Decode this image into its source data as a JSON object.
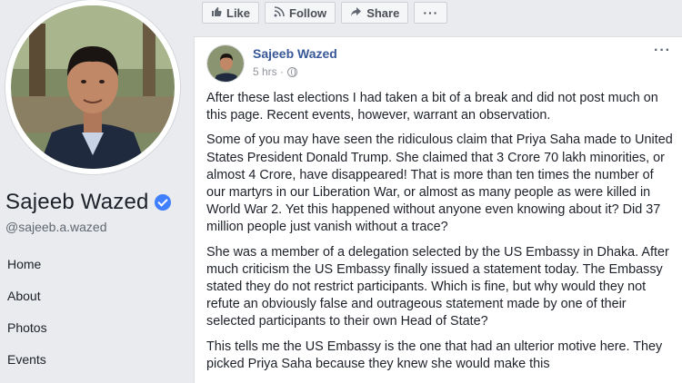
{
  "profile": {
    "name": "Sajeeb Wazed",
    "username": "@sajeeb.a.wazed"
  },
  "nav": {
    "items": [
      {
        "label": "Home"
      },
      {
        "label": "About"
      },
      {
        "label": "Photos"
      },
      {
        "label": "Events"
      }
    ]
  },
  "actions": {
    "like": "Like",
    "follow": "Follow",
    "share": "Share",
    "more": "···"
  },
  "post": {
    "author": "Sajeeb Wazed",
    "time": "5 hrs ·",
    "options": "···",
    "paragraphs": [
      "After these last elections I had taken a bit of a break and did not post much on this page. Recent events, however, warrant an observation.",
      "Some of you may have seen the ridiculous claim that Priya Saha made to United States President Donald Trump. She claimed that 3 Crore 70 lakh minorities, or almost 4 Crore, have disappeared! That is more than ten times the number of our martyrs in our Liberation War, or almost as many people as were killed in World War 2. Yet this happened without anyone even knowing about it? Did 37 million people just vanish without a trace?",
      "She was a member of a delegation selected by the US Embassy in Dhaka. After much criticism the US Embassy finally issued a statement today. The Embassy stated they do not restrict participants. Which is fine, but why would they not refute an obviously false and outrageous statement made by one of their selected participants to their own Head of State?",
      "This tells me the US Embassy is the one that had an ulterior motive here. They picked Priya Saha because they knew she would make this"
    ]
  },
  "icons": {
    "like": "thumbs-up-icon",
    "follow": "rss-icon",
    "share": "share-arrow-icon",
    "verified": "verified-badge-icon",
    "privacy": "globe-icon"
  },
  "colors": {
    "link": "#385898",
    "verified": "#4080ff",
    "background": "#e9ebee"
  }
}
